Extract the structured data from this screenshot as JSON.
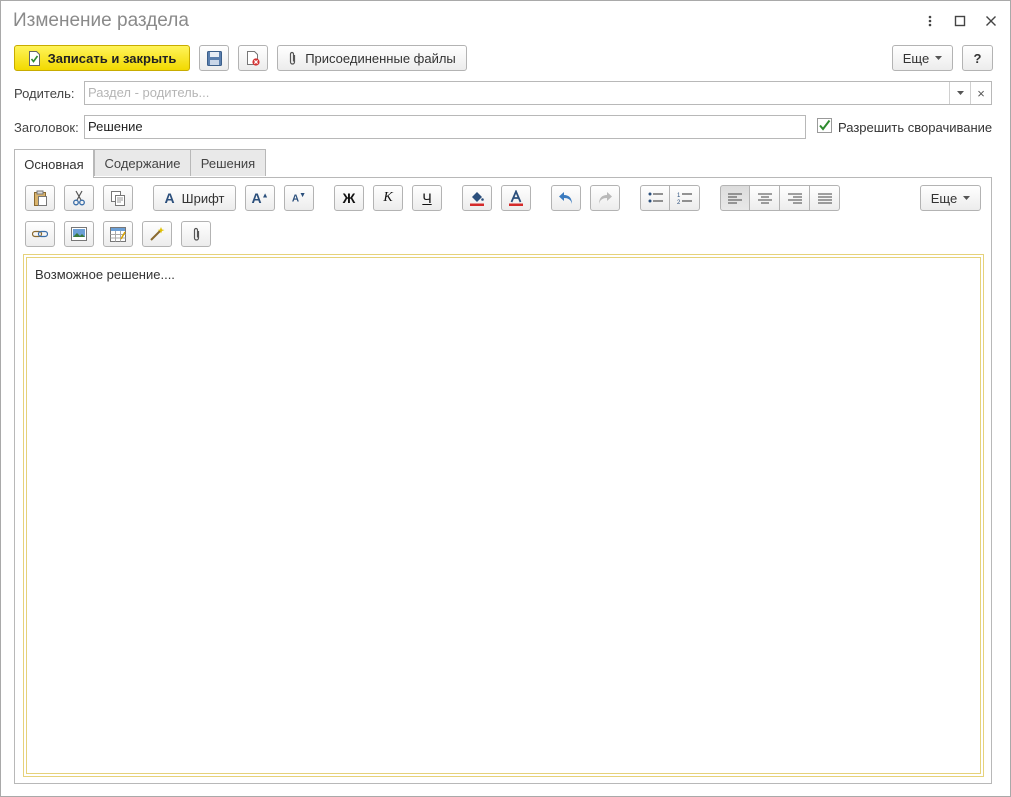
{
  "window": {
    "title": "Изменение раздела",
    "controls": [
      "menu-icon",
      "maximize-icon",
      "close-icon"
    ]
  },
  "toolbar": {
    "save_close_label": "Записать и закрыть",
    "attached_files_label": "Присоединенные файлы",
    "more_label": "Еще",
    "help_label": "?"
  },
  "form": {
    "parent_label": "Родитель:",
    "parent_placeholder": "Раздел - родитель...",
    "parent_clear": "×",
    "header_label": "Заголовок:",
    "header_value": "Решение",
    "allow_collapse_label": "Разрешить сворачивание",
    "allow_collapse_checked": true
  },
  "tabs": [
    {
      "label": "Основная",
      "active": true
    },
    {
      "label": "Содержание",
      "active": false
    },
    {
      "label": "Решения",
      "active": false
    }
  ],
  "editor_toolbar": {
    "font_label": "Шрифт",
    "bold_label": "Ж",
    "italic_label": "К",
    "underline_label": "Ч",
    "more_label": "Еще",
    "align_active": "left"
  },
  "editor": {
    "content": "Возможное решение...."
  },
  "colors": {
    "primary_button": "#f5dd00",
    "editor_border": "#e6d27a",
    "checkbox_check": "#2e8b2e"
  }
}
